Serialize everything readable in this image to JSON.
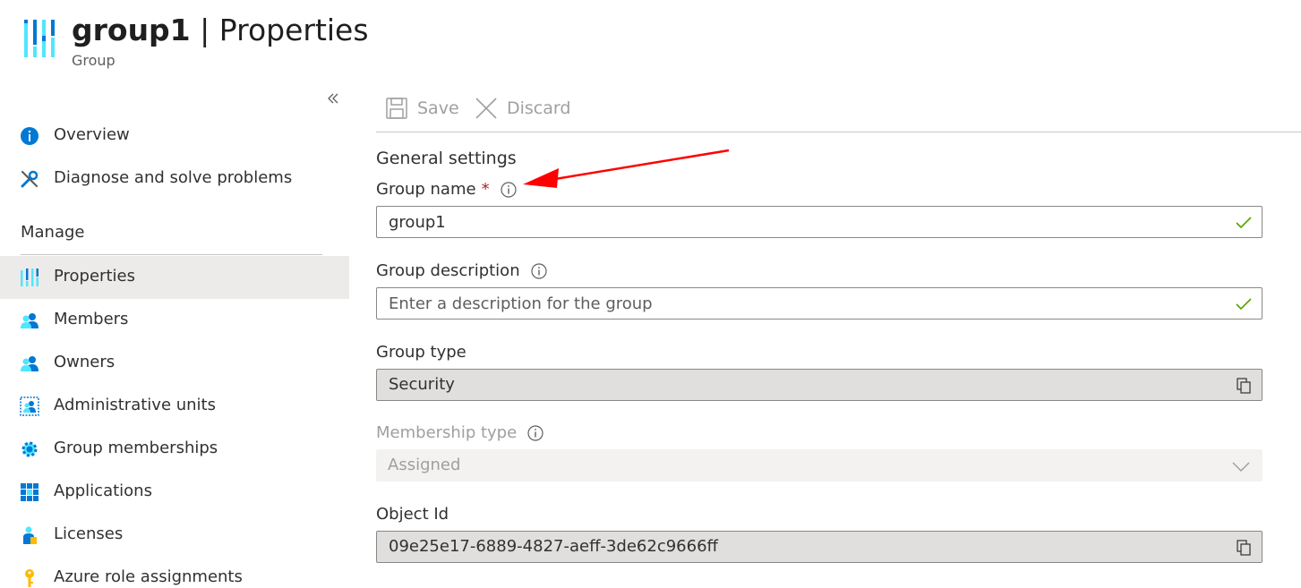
{
  "header": {
    "title": "group1",
    "separator": "|",
    "page": "Properties",
    "subtitle": "Group"
  },
  "sidebar": {
    "collapse_icon": "double-chevron-left-icon",
    "items": [
      {
        "label": "Overview",
        "icon": "info-icon"
      },
      {
        "label": "Diagnose and solve problems",
        "icon": "wrench-icon"
      }
    ],
    "manage_title": "Manage",
    "manage_items": [
      {
        "label": "Properties",
        "icon": "properties-icon",
        "active": true
      },
      {
        "label": "Members",
        "icon": "members-icon"
      },
      {
        "label": "Owners",
        "icon": "owners-icon"
      },
      {
        "label": "Administrative units",
        "icon": "admin-units-icon"
      },
      {
        "label": "Group memberships",
        "icon": "gear-icon"
      },
      {
        "label": "Applications",
        "icon": "grid-icon"
      },
      {
        "label": "Licenses",
        "icon": "license-icon"
      },
      {
        "label": "Azure role assignments",
        "icon": "key-icon"
      }
    ]
  },
  "toolbar": {
    "save_label": "Save",
    "discard_label": "Discard"
  },
  "form": {
    "section_title": "General settings",
    "group_name": {
      "label": "Group name",
      "required_mark": "*",
      "value": "group1"
    },
    "group_description": {
      "label": "Group description",
      "placeholder": "Enter a description for the group",
      "value": ""
    },
    "group_type": {
      "label": "Group type",
      "value": "Security"
    },
    "membership_type": {
      "label": "Membership type",
      "value": "Assigned"
    },
    "object_id": {
      "label": "Object Id",
      "value": "09e25e17-6889-4827-aeff-3de62c9666ff"
    }
  },
  "colors": {
    "accent": "#0078d4",
    "valid_check": "#57a300",
    "required": "#a4262c",
    "annotation_arrow": "#ff0000",
    "active_nav_bg": "#edebe9"
  }
}
